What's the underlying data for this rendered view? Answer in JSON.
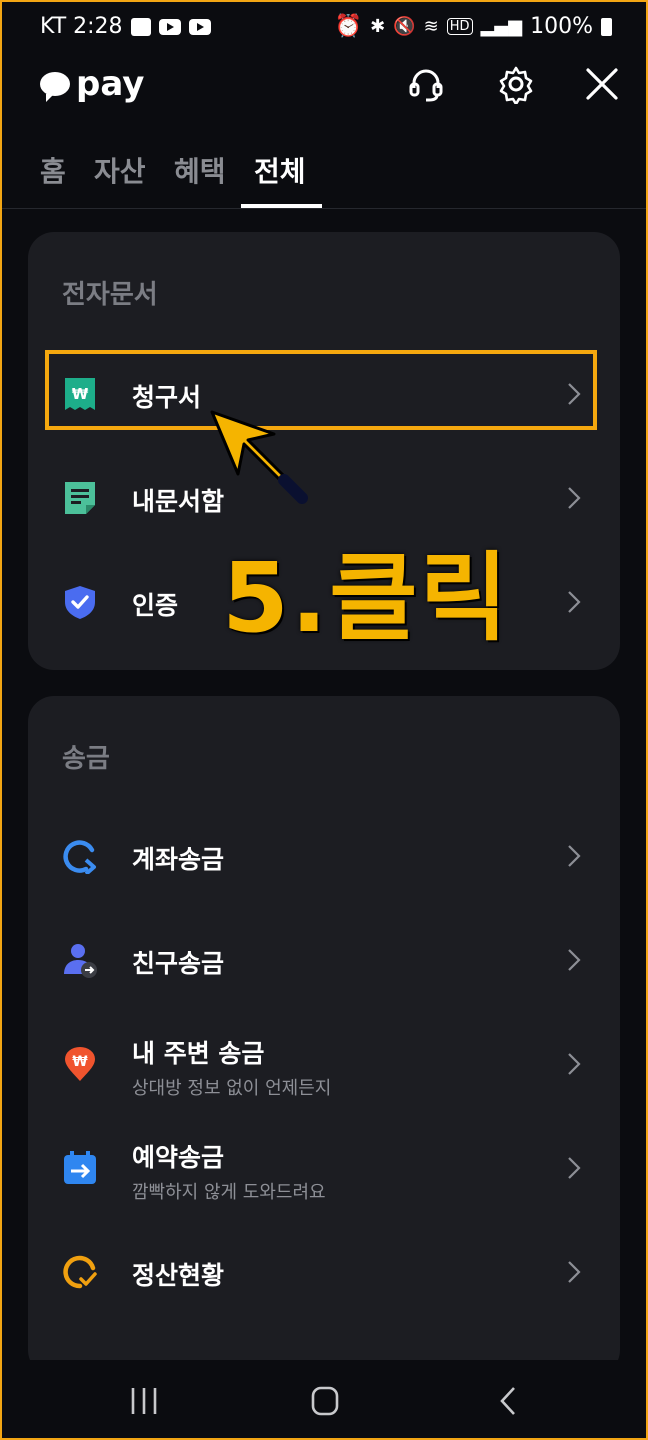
{
  "status_bar": {
    "carrier_time": "KT 2:28",
    "network": "HD",
    "battery": "100%"
  },
  "header": {
    "logo_text": "pay"
  },
  "tabs": [
    {
      "label": "홈"
    },
    {
      "label": "자산"
    },
    {
      "label": "혜택"
    },
    {
      "label": "전체",
      "active": true
    }
  ],
  "sections": [
    {
      "title": "전자문서",
      "items": [
        {
          "label": "청구서",
          "icon": "bill-icon",
          "icon_color": "#1dae8a"
        },
        {
          "label": "내문서함",
          "icon": "document-icon",
          "icon_color": "#4cc09a"
        },
        {
          "label": "인증",
          "icon": "shield-check-icon",
          "icon_color": "#4a6cf0"
        }
      ]
    },
    {
      "title": "송금",
      "items": [
        {
          "label": "계좌송금",
          "icon": "account-transfer-icon",
          "icon_color": "#3b8cf0"
        },
        {
          "label": "친구송금",
          "icon": "friend-transfer-icon",
          "icon_color": "#5a6ff0"
        },
        {
          "label": "내 주변 송금",
          "sub": "상대방 정보 없이 언제든지",
          "icon": "nearby-transfer-icon",
          "icon_color": "#f0542e"
        },
        {
          "label": "예약송금",
          "sub": "깜빡하지 않게 도와드려요",
          "icon": "scheduled-transfer-icon",
          "icon_color": "#2f86f0"
        },
        {
          "label": "정산현황",
          "icon": "settlement-icon",
          "icon_color": "#f0a010"
        }
      ]
    }
  ],
  "annotation": {
    "text": "5.클릭",
    "color": "#f5b400"
  }
}
